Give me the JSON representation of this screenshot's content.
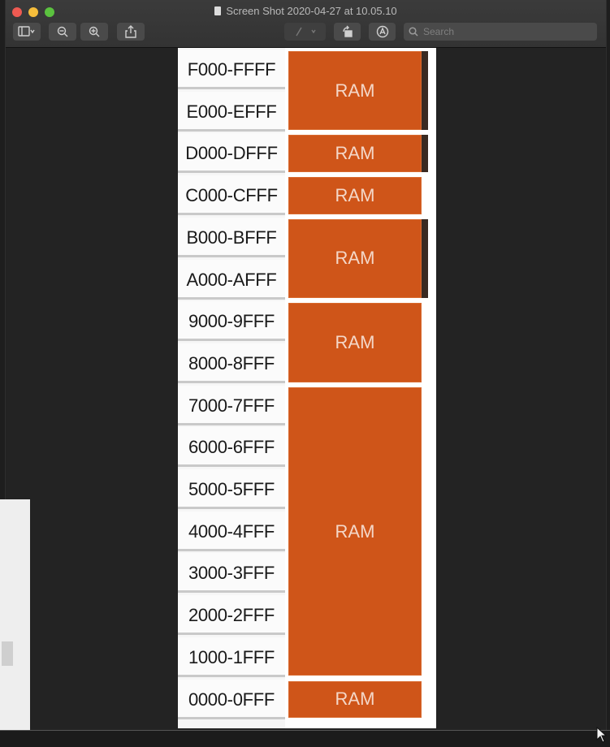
{
  "window": {
    "title": "Screen Shot 2020-04-27 at 10.05.10"
  },
  "toolbar": {
    "sidebar_icon": "sidebar-icon",
    "zoom_out_icon": "zoom-out-icon",
    "zoom_in_icon": "zoom-in-icon",
    "share_icon": "share-icon",
    "markup_icon": "pen-icon",
    "rotate_icon": "rotate-icon",
    "annotate_icon": "annotate-icon",
    "search_placeholder": "Search"
  },
  "memory_map": {
    "addresses": [
      "F000-FFFF",
      "E000-EFFF",
      "D000-DFFF",
      "C000-CFFF",
      "B000-BFFF",
      "A000-AFFF",
      "9000-9FFF",
      "8000-8FFF",
      "7000-7FFF",
      "6000-6FFF",
      "5000-5FFF",
      "4000-4FFF",
      "3000-3FFF",
      "2000-2FFF",
      "1000-1FFF",
      "0000-0FFF"
    ],
    "blocks": [
      {
        "label": "RAM",
        "rows": 2
      },
      {
        "label": "RAM",
        "rows": 1
      },
      {
        "label": "RAM",
        "rows": 1
      },
      {
        "label": "RAM",
        "rows": 2
      },
      {
        "label": "RAM",
        "rows": 2
      },
      {
        "label": "RAM",
        "rows": 7
      },
      {
        "label": "RAM",
        "rows": 1
      }
    ],
    "colors": {
      "ram_fill": "#cf5519",
      "ram_text": "#f4d7c8"
    }
  }
}
